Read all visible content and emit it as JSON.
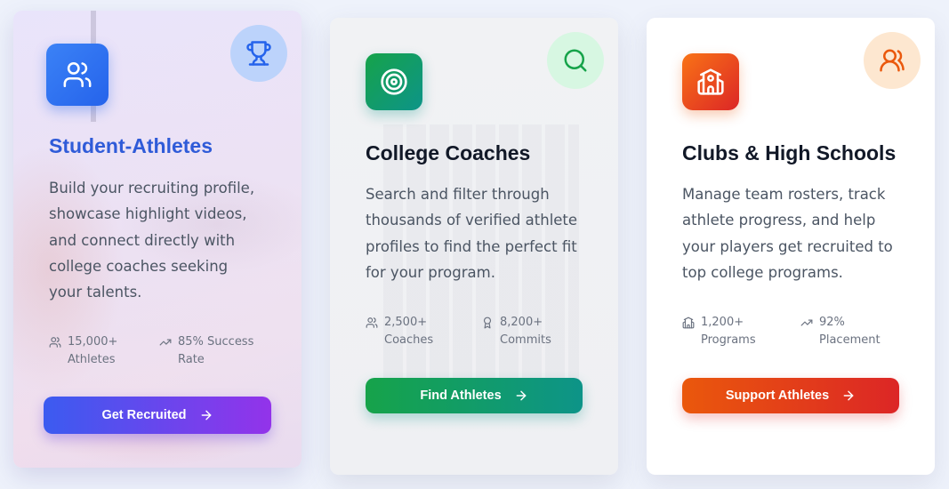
{
  "cards": [
    {
      "title": "Student-Athletes",
      "description_lines": [
        "Build your recruiting profile,",
        "showcase highlight videos,",
        "and connect directly with",
        "college coaches seeking",
        "your talents."
      ],
      "stats": [
        {
          "line1": "15,000+",
          "line2": "Athletes",
          "icon": "users-icon"
        },
        {
          "line1": "85% Success",
          "line2": "Rate",
          "icon": "trending-up-icon"
        }
      ],
      "button_label": "Get Recruited",
      "icon": "users-icon",
      "corner_icon": "trophy-icon",
      "colors": {
        "title": "#2f5bd8",
        "button_from": "#3b5bf0",
        "button_to": "#9333ea"
      }
    },
    {
      "title": "College Coaches",
      "description_lines": [
        "Search and filter through",
        "thousands of verified athlete",
        "profiles to find the perfect fit",
        "for your program."
      ],
      "stats": [
        {
          "line1": "2,500+",
          "line2": "Coaches",
          "icon": "users-icon"
        },
        {
          "line1": "8,200+",
          "line2": "Commits",
          "icon": "award-icon"
        }
      ],
      "button_label": "Find Athletes",
      "icon": "target-icon",
      "corner_icon": "search-icon",
      "colors": {
        "title": "#111827",
        "button_from": "#16a34a",
        "button_to": "#0d9488"
      }
    },
    {
      "title": "Clubs & High Schools",
      "description_lines": [
        "Manage team rosters, track",
        "athlete progress, and help",
        "your players get recruited to",
        "top college programs."
      ],
      "stats": [
        {
          "line1": "1,200+",
          "line2": "Programs",
          "icon": "school-icon"
        },
        {
          "line1": "92%",
          "line2": "Placement",
          "icon": "trending-up-icon"
        }
      ],
      "button_label": "Support Athletes",
      "icon": "school-icon",
      "corner_icon": "users-icon",
      "colors": {
        "title": "#111827",
        "button_from": "#ea580c",
        "button_to": "#dc2626"
      }
    }
  ]
}
